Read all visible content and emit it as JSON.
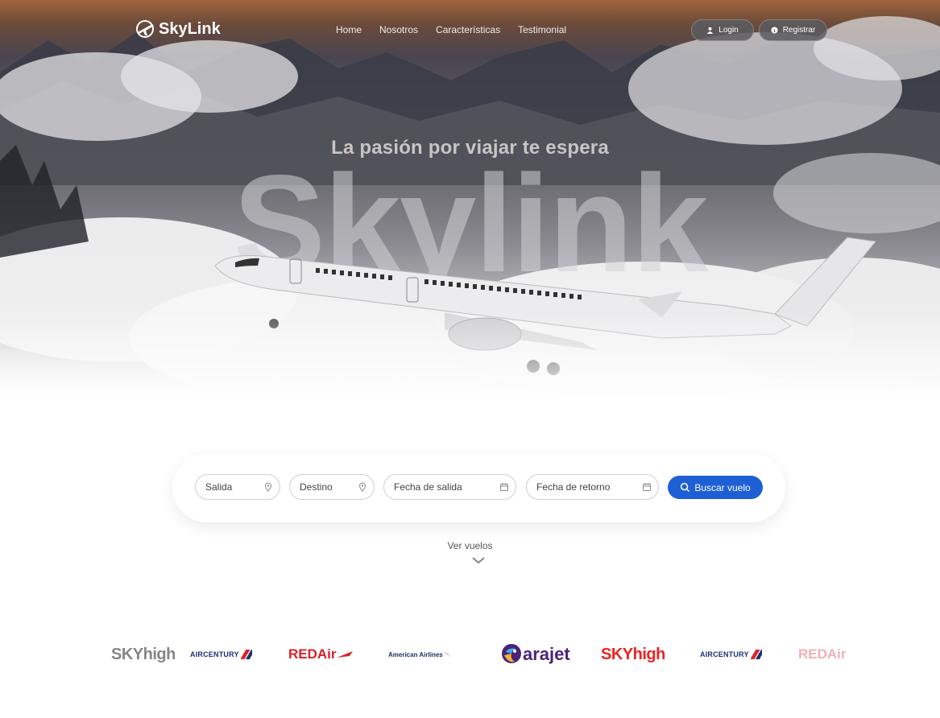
{
  "brand": {
    "name": "SkyLink"
  },
  "nav": {
    "items": [
      {
        "label": "Home"
      },
      {
        "label": "Nosotros"
      },
      {
        "label": "Características"
      },
      {
        "label": "Testimonial"
      }
    ],
    "login_label": "Login",
    "register_label": "Registrar"
  },
  "hero": {
    "tagline": "La pasión por viajar te espera",
    "big_word": "Skylink"
  },
  "search": {
    "departure_placeholder": "Salida",
    "destination_placeholder": "Destino",
    "departure_date_placeholder": "Fecha de salida",
    "return_date_placeholder": "Fecha de retorno",
    "button_label": "Buscar vuelo"
  },
  "view_flights": "Ver vuelos",
  "airlines": [
    "SKYhigh",
    "AIRCENTURY",
    "REDAir",
    "American Airlines",
    "arajet",
    "SKYhigh",
    "AIRCENTURY",
    "REDAir"
  ],
  "colors": {
    "primary": "#1f5fd6",
    "skyhigh_red": "#e22222",
    "redair_red": "#d8202b",
    "arajet_purple": "#4b2379"
  }
}
